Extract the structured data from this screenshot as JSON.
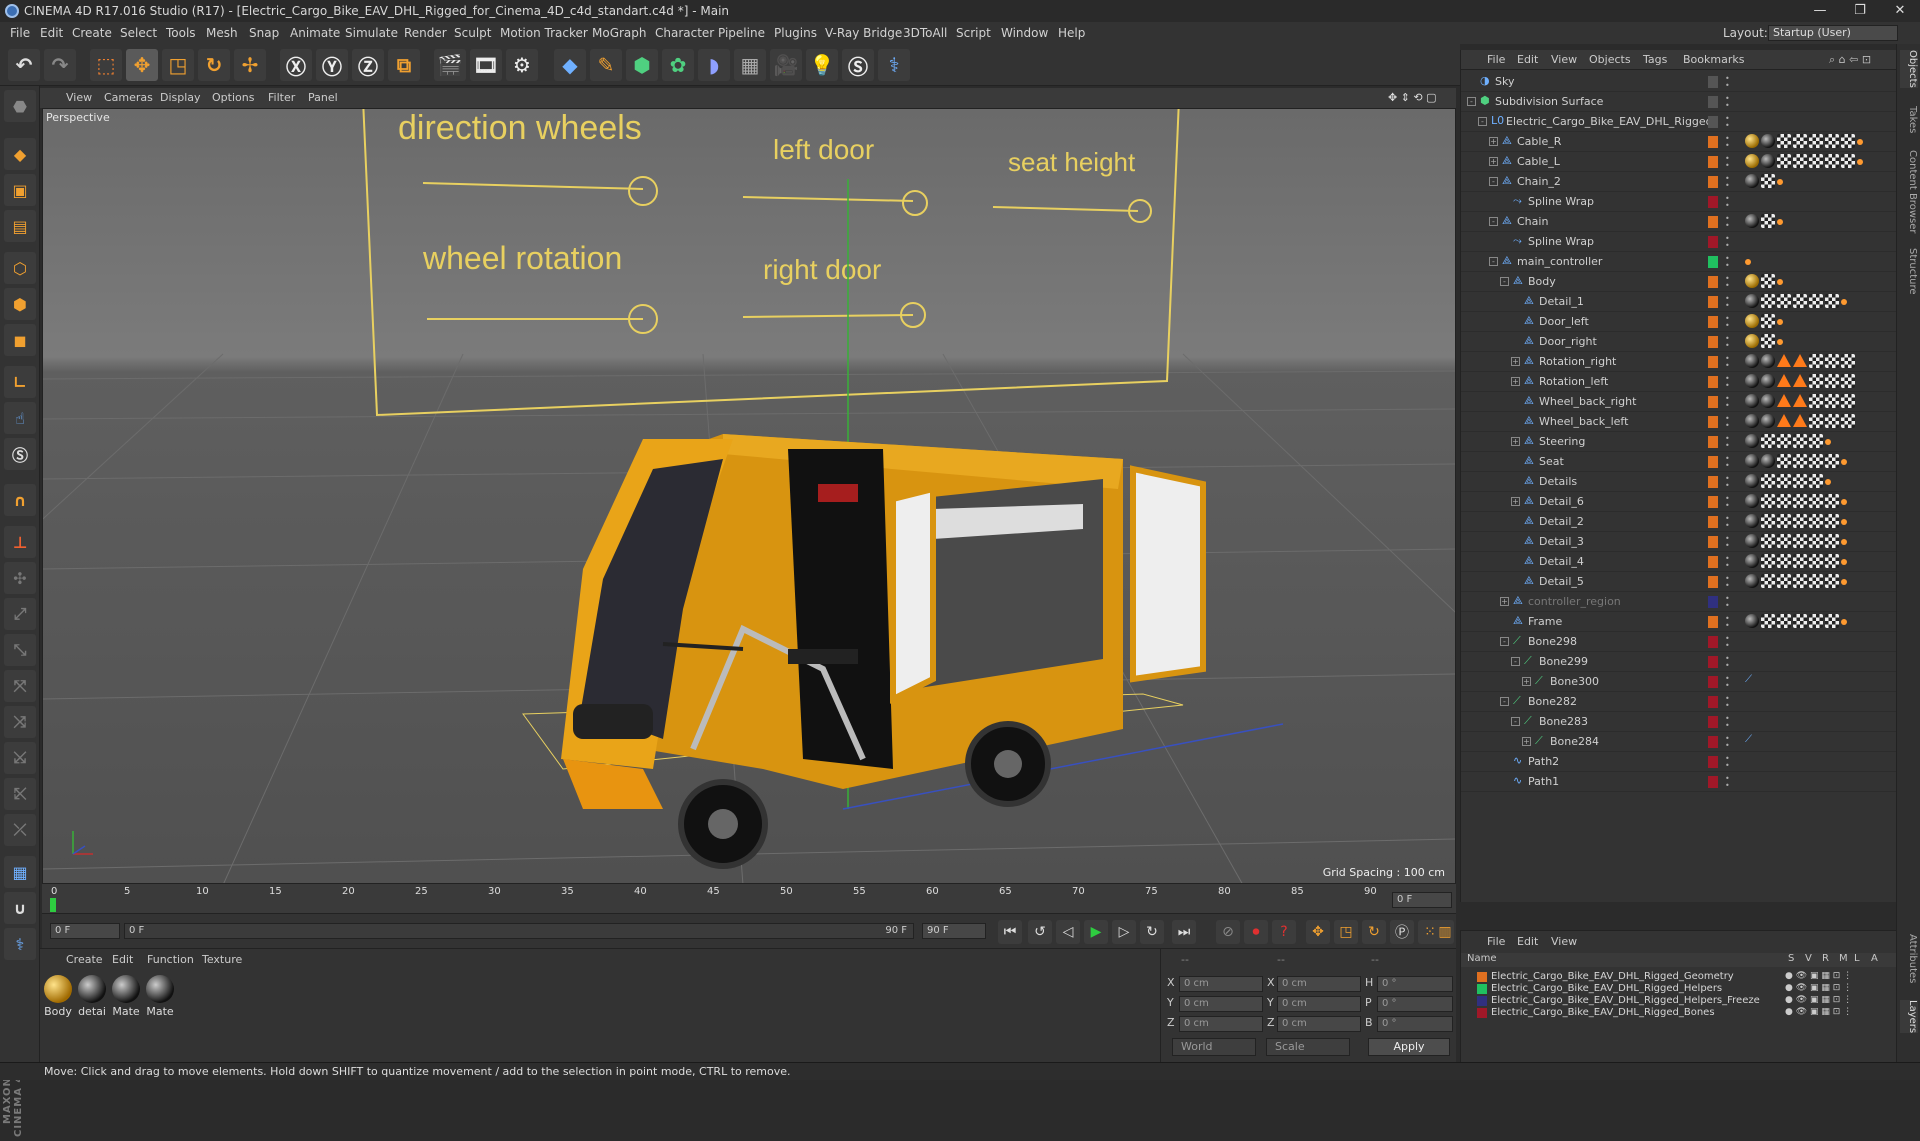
{
  "window": {
    "title": "CINEMA 4D R17.016 Studio (R17) - [Electric_Cargo_Bike_EAV_DHL_Rigged_for_Cinema_4D_c4d_standart.c4d *] - Main"
  },
  "menu": [
    "File",
    "Edit",
    "Create",
    "Select",
    "Tools",
    "Mesh",
    "Snap",
    "Animate",
    "Simulate",
    "Render",
    "Sculpt",
    "Motion Tracker",
    "MoGraph",
    "Character",
    "Pipeline",
    "Plugins",
    "V-Ray Bridge",
    "3DToAll",
    "Script",
    "Window",
    "Help"
  ],
  "layout": {
    "label": "Layout:",
    "value": "Startup (User)"
  },
  "viewport": {
    "menu": [
      "View",
      "Cameras",
      "Display",
      "Options",
      "Filter",
      "Panel"
    ],
    "label": "Perspective",
    "grid_spacing": "Grid Spacing : 100 cm",
    "controller_labels": [
      "direction wheels",
      "left door",
      "seat height",
      "wheel rotation",
      "right door"
    ]
  },
  "timeline": {
    "ticks": [
      "0",
      "5",
      "10",
      "15",
      "20",
      "25",
      "30",
      "35",
      "40",
      "45",
      "50",
      "55",
      "60",
      "65",
      "70",
      "75",
      "80",
      "85",
      "90"
    ],
    "current_frame": "0 F"
  },
  "transport": {
    "start": "0 F",
    "slider_start": "0 F",
    "slider_end": "90 F",
    "end": "90 F"
  },
  "materials": {
    "menu": [
      "Create",
      "Edit",
      "Function",
      "Texture"
    ],
    "items": [
      "Body",
      "detai",
      "Mate",
      "Mate"
    ]
  },
  "coords": {
    "rows": [
      {
        "a1": "X",
        "v1": "0 cm",
        "a2": "X",
        "v2": "0 cm",
        "a3": "H",
        "v3": "0 °"
      },
      {
        "a1": "Y",
        "v1": "0 cm",
        "a2": "Y",
        "v2": "0 cm",
        "a3": "P",
        "v3": "0 °"
      },
      {
        "a1": "Z",
        "v1": "0 cm",
        "a2": "Z",
        "v2": "0 cm",
        "a3": "B",
        "v3": "0 °"
      }
    ],
    "mode": "World",
    "scale": "Scale",
    "apply": "Apply",
    "header": [
      "--",
      "--",
      "--"
    ]
  },
  "status": "Move: Click and drag to move elements. Hold down SHIFT to quantize movement / add to the selection in point mode, CTRL to remove.",
  "objects": {
    "menu": [
      "File",
      "Edit",
      "View",
      "Objects",
      "Tags",
      "Bookmarks"
    ],
    "rows": [
      {
        "name": "Sky",
        "depth": 0,
        "exp": "",
        "layer": "#555"
      },
      {
        "name": "Subdivision Surface",
        "depth": 0,
        "exp": "-",
        "layer": "#555"
      },
      {
        "name": "Electric_Cargo_Bike_EAV_DHL_Rigged",
        "depth": 1,
        "exp": "-",
        "layer": "#555"
      },
      {
        "name": "Cable_R",
        "depth": 2,
        "exp": "+",
        "layer": "#e07020"
      },
      {
        "name": "Cable_L",
        "depth": 2,
        "exp": "+",
        "layer": "#e07020"
      },
      {
        "name": "Chain_2",
        "depth": 2,
        "exp": "-",
        "layer": "#e07020"
      },
      {
        "name": "Spline Wrap",
        "depth": 3,
        "exp": "",
        "layer": "#a01828"
      },
      {
        "name": "Chain",
        "depth": 2,
        "exp": "-",
        "layer": "#e07020"
      },
      {
        "name": "Spline Wrap",
        "depth": 3,
        "exp": "",
        "layer": "#a01828"
      },
      {
        "name": "main_controller",
        "depth": 2,
        "exp": "-",
        "layer": "#20c060"
      },
      {
        "name": "Body",
        "depth": 3,
        "exp": "-",
        "layer": "#e07020"
      },
      {
        "name": "Detail_1",
        "depth": 4,
        "exp": "",
        "layer": "#e07020"
      },
      {
        "name": "Door_left",
        "depth": 4,
        "exp": "",
        "layer": "#e07020"
      },
      {
        "name": "Door_right",
        "depth": 4,
        "exp": "",
        "layer": "#e07020"
      },
      {
        "name": "Rotation_right",
        "depth": 4,
        "exp": "+",
        "layer": "#e07020"
      },
      {
        "name": "Rotation_left",
        "depth": 4,
        "exp": "+",
        "layer": "#e07020"
      },
      {
        "name": "Wheel_back_right",
        "depth": 4,
        "exp": "",
        "layer": "#e07020"
      },
      {
        "name": "Wheel_back_left",
        "depth": 4,
        "exp": "",
        "layer": "#e07020"
      },
      {
        "name": "Steering",
        "depth": 4,
        "exp": "+",
        "layer": "#e07020"
      },
      {
        "name": "Seat",
        "depth": 4,
        "exp": "",
        "layer": "#e07020"
      },
      {
        "name": "Details",
        "depth": 4,
        "exp": "",
        "layer": "#e07020"
      },
      {
        "name": "Detail_6",
        "depth": 4,
        "exp": "+",
        "layer": "#e07020"
      },
      {
        "name": "Detail_2",
        "depth": 4,
        "exp": "",
        "layer": "#e07020"
      },
      {
        "name": "Detail_3",
        "depth": 4,
        "exp": "",
        "layer": "#e07020"
      },
      {
        "name": "Detail_4",
        "depth": 4,
        "exp": "",
        "layer": "#e07020"
      },
      {
        "name": "Detail_5",
        "depth": 4,
        "exp": "",
        "layer": "#e07020"
      },
      {
        "name": "controller_region",
        "depth": 3,
        "exp": "+",
        "layer": "#303080"
      },
      {
        "name": "Frame",
        "depth": 3,
        "exp": "",
        "layer": "#e07020"
      },
      {
        "name": "Bone298",
        "depth": 3,
        "exp": "-",
        "layer": "#a01828"
      },
      {
        "name": "Bone299",
        "depth": 4,
        "exp": "-",
        "layer": "#a01828"
      },
      {
        "name": "Bone300",
        "depth": 5,
        "exp": "+",
        "layer": "#a01828"
      },
      {
        "name": "Bone282",
        "depth": 3,
        "exp": "-",
        "layer": "#a01828"
      },
      {
        "name": "Bone283",
        "depth": 4,
        "exp": "-",
        "layer": "#a01828"
      },
      {
        "name": "Bone284",
        "depth": 5,
        "exp": "+",
        "layer": "#a01828"
      },
      {
        "name": "Path2",
        "depth": 3,
        "exp": "",
        "layer": "#a01828"
      },
      {
        "name": "Path1",
        "depth": 3,
        "exp": "",
        "layer": "#a01828"
      }
    ]
  },
  "layers": {
    "menu": [
      "File",
      "Edit",
      "View"
    ],
    "header": {
      "name": "Name",
      "s": "S",
      "v": "V",
      "r": "R",
      "m": "M",
      "l": "L",
      "a": "A"
    },
    "rows": [
      {
        "name": "Electric_Cargo_Bike_EAV_DHL_Rigged_Geometry",
        "color": "#e07020"
      },
      {
        "name": "Electric_Cargo_Bike_EAV_DHL_Rigged_Helpers",
        "color": "#20c060"
      },
      {
        "name": "Electric_Cargo_Bike_EAV_DHL_Rigged_Helpers_Freeze",
        "color": "#303080"
      },
      {
        "name": "Electric_Cargo_Bike_EAV_DHL_Rigged_Bones",
        "color": "#a01828"
      }
    ]
  },
  "side_tabs": [
    "Objects",
    "Takes",
    "Content Browser",
    "Structure",
    "Attributes",
    "Layers"
  ]
}
